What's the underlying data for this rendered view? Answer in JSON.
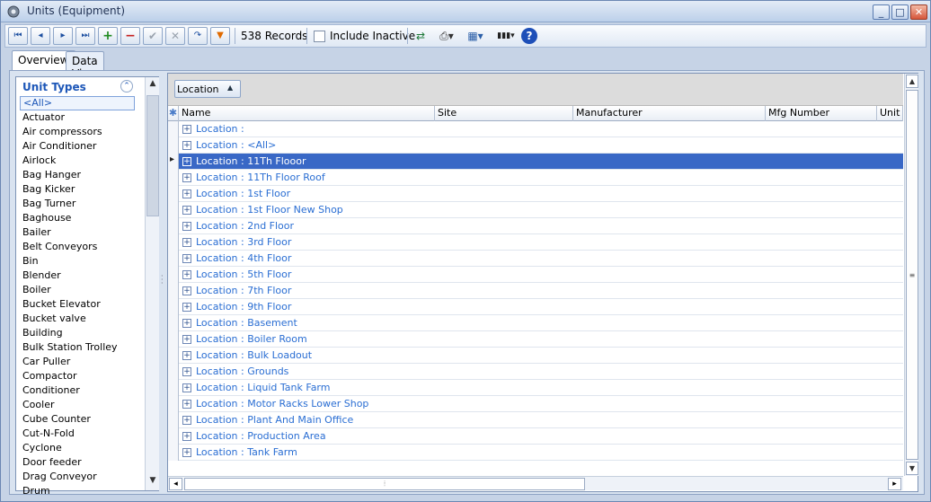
{
  "window": {
    "title": "Units (Equipment)",
    "min_glyph": "_",
    "max_glyph": "□",
    "close_glyph": "✕"
  },
  "toolbar": {
    "first_glyph": "⏮",
    "prev_glyph": "◂",
    "next_glyph": "▸",
    "last_glyph": "⏭",
    "add_glyph": "+",
    "delete_glyph": "−",
    "post_glyph": "✔",
    "cancel_glyph": "✕",
    "refresh_glyph": "↷",
    "filter_glyph": "▼",
    "records": "538 Records",
    "include_inactive": "Include Inactive",
    "sync_glyph": "⇄",
    "print_glyph": "⎙▾",
    "layout_glyph": "▦▾",
    "barcode_glyph": "▮▮▮▾",
    "help_glyph": "?"
  },
  "tabs": [
    {
      "label": "Overview"
    },
    {
      "label": "Data View"
    }
  ],
  "left_panel": {
    "header": "Unit Types",
    "collapse_glyph": "⌃",
    "items": [
      "<All>",
      "Actuator",
      "Air compressors",
      "Air Conditioner",
      "Airlock",
      "Bag Hanger",
      "Bag Kicker",
      "Bag Turner",
      "Baghouse",
      "Bailer",
      "Belt Conveyors",
      "Bin",
      "Blender",
      "Boiler",
      "Bucket Elevator",
      "Bucket valve",
      "Building",
      "Bulk Station Trolley",
      "Car Puller",
      "Compactor",
      "Conditioner",
      "Cooler",
      "Cube Counter",
      "Cut-N-Fold",
      "Cyclone",
      "Door feeder",
      "Drag Conveyor",
      "Drum"
    ],
    "scroll_up_glyph": "▲",
    "scroll_down_glyph": "▼"
  },
  "grid": {
    "group_by": "Location",
    "group_chevron": "▲",
    "new_row_glyph": "✱",
    "columns": [
      "Name",
      "Site",
      "Manufacturer",
      "Mfg Number",
      "Unit Number"
    ],
    "expand_glyph": "+",
    "rows": [
      "Location :",
      "Location : <All>",
      "Location : 11Th Flooor",
      "Location : 11Th Floor Roof",
      "Location : 1st Floor",
      "Location : 1st Floor New Shop",
      "Location : 2nd Floor",
      "Location : 3rd Floor",
      "Location : 4th Floor",
      "Location : 5th Floor",
      "Location : 7th Floor",
      "Location : 9th Floor",
      "Location : Basement",
      "Location : Boiler Room",
      "Location : Bulk Loadout",
      "Location : Grounds",
      "Location : Liquid Tank Farm",
      "Location : Motor Racks Lower Shop",
      "Location : Plant And Main Office",
      "Location : Production Area",
      "Location : Tank Farm"
    ],
    "selected_row": 2,
    "scroll_up_glyph": "▲",
    "scroll_down_glyph": "▼",
    "scroll_left_glyph": "◂",
    "scroll_right_glyph": "▸",
    "v_grip": "≡",
    "h_grip": "⦙"
  },
  "colors": {
    "accent": "#3968c6",
    "link_text": "#2a6ed3",
    "header_text": "#1d57b8"
  }
}
